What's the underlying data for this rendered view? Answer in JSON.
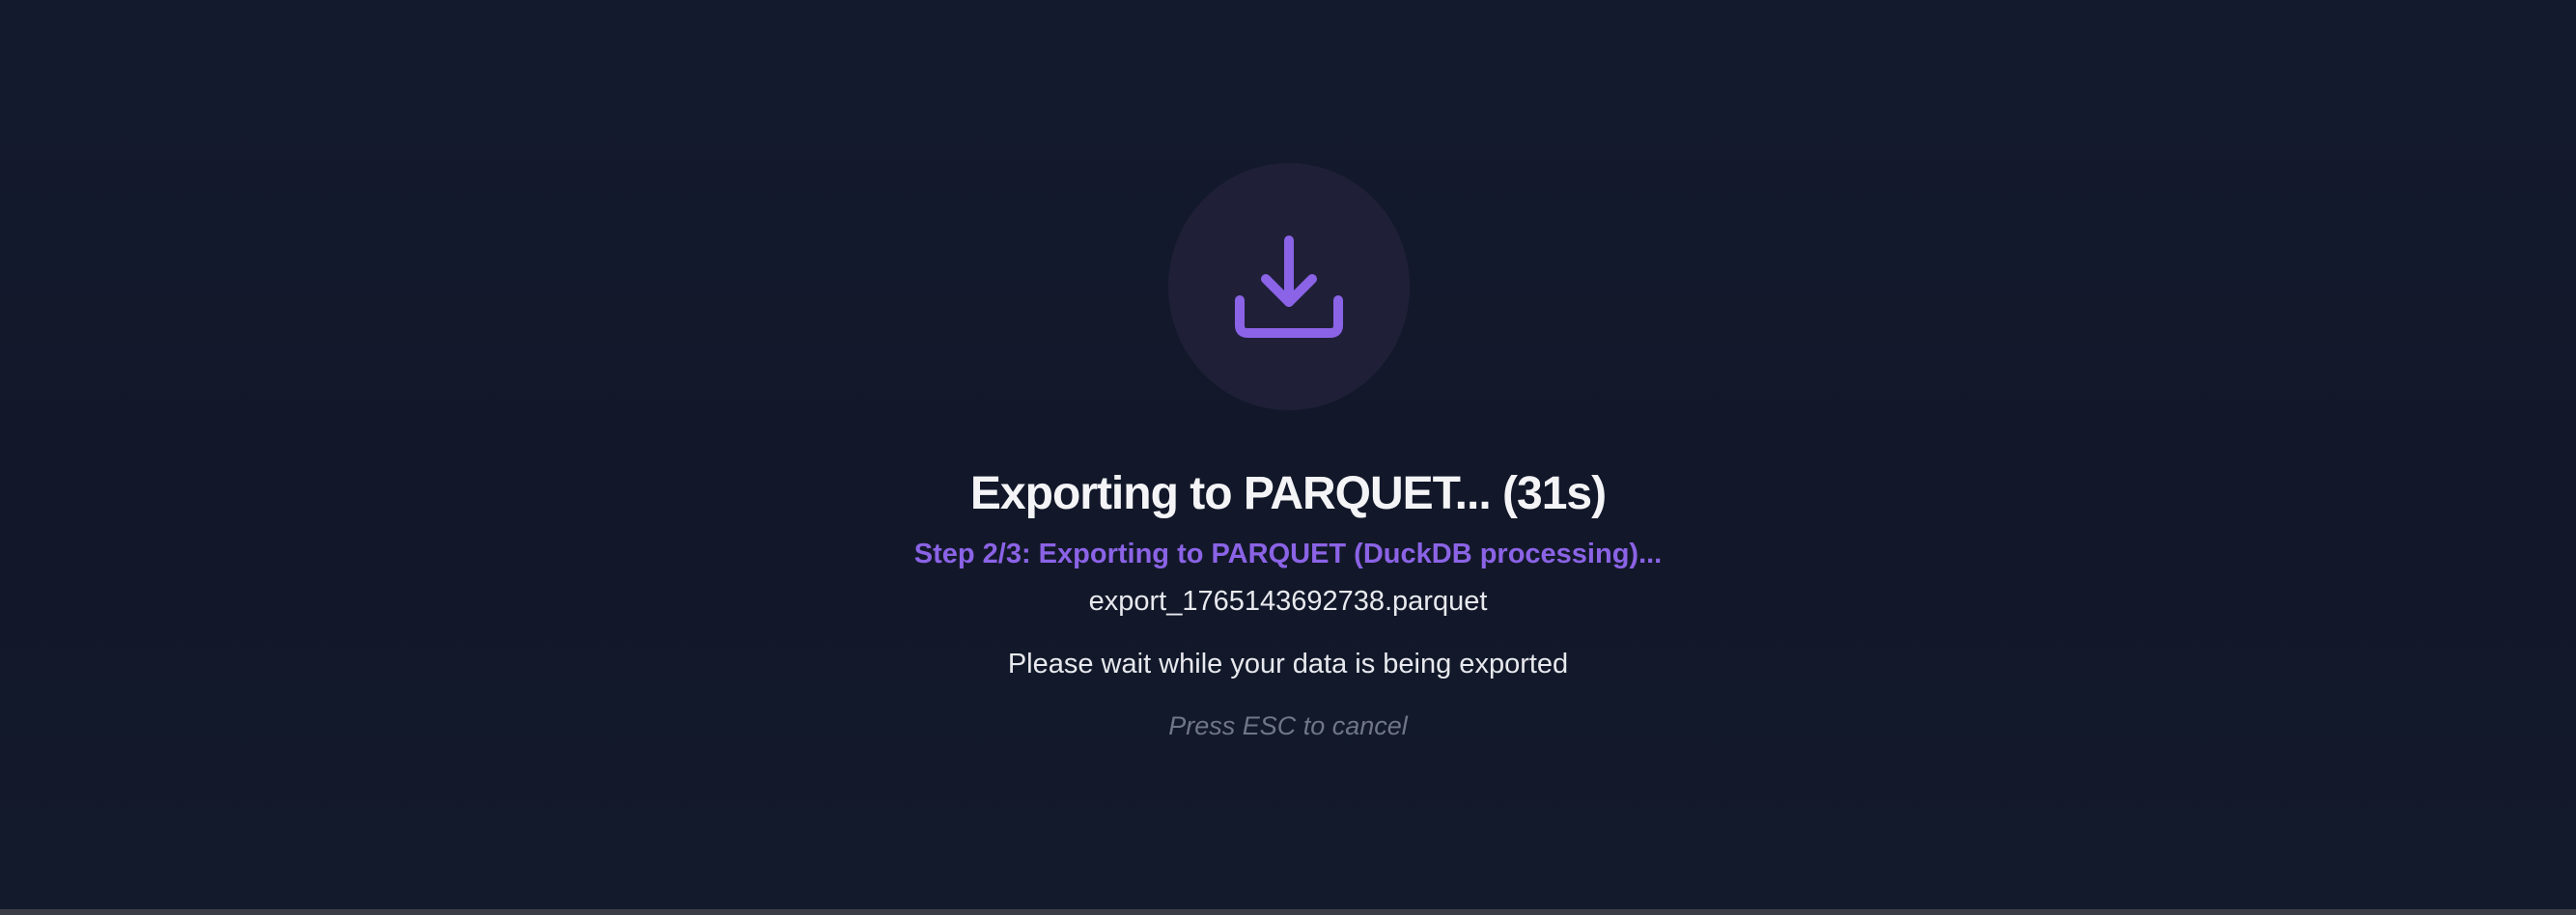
{
  "export_dialog": {
    "icon": "download-icon",
    "title": "Exporting to PARQUET... (31s)",
    "step_text": "Step 2/3: Exporting to PARQUET (DuckDB processing)...",
    "filename": "export_1765143692738.parquet",
    "message": "Please wait while your data is being exported",
    "cancel_hint": "Press ESC to cancel",
    "colors": {
      "accent": "#8b63e6",
      "background": "#131a2c",
      "icon_circle": "#1f2038",
      "title": "#f4f4f7",
      "muted": "#6f7688"
    }
  }
}
